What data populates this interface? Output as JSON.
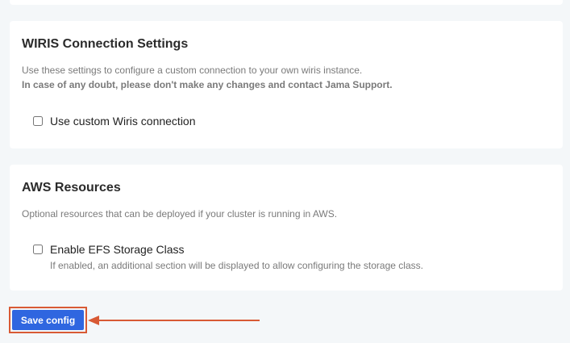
{
  "wiris": {
    "title": "WIRIS Connection Settings",
    "description": "Use these settings to configure a custom connection to your own wiris instance.",
    "warning": "In case of any doubt, please don't make any changes and contact Jama Support.",
    "custom_connection_label": "Use custom Wiris connection",
    "custom_connection_checked": false
  },
  "aws": {
    "title": "AWS Resources",
    "description": "Optional resources that can be deployed if your cluster is running in AWS.",
    "efs_label": "Enable EFS Storage Class",
    "efs_helper": "If enabled, an additional section will be displayed to allow configuring the storage class.",
    "efs_checked": false
  },
  "actions": {
    "save_label": "Save config"
  },
  "colors": {
    "primary_button": "#2f66e0",
    "annotation": "#d85a35",
    "page_background": "#f4f7f9"
  }
}
